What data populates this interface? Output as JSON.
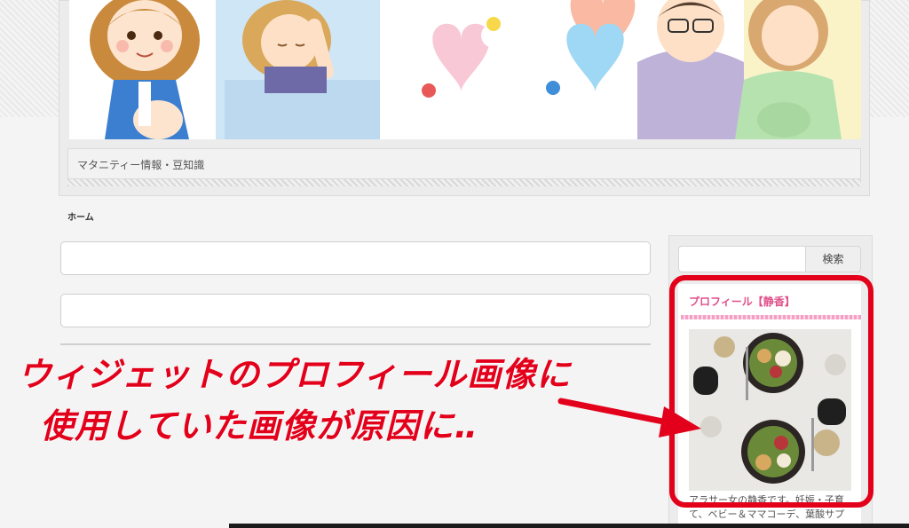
{
  "header": {
    "tagline": "マタニティー情報・豆知識"
  },
  "breadcrumb": {
    "home": "ホーム"
  },
  "sidebar": {
    "search": {
      "placeholder": "",
      "button_label": "検索"
    },
    "profile_widget": {
      "title": "プロフィール【静香】",
      "text": "アラサー女の静香です。妊娠・子育て、ベビー＆ママコーデ、葉酸サプ"
    }
  },
  "annotation": {
    "line1": "ウィジェットのプロフィール画像に",
    "line2": "使用していた画像が原因に‥",
    "color": "#e3001b"
  }
}
